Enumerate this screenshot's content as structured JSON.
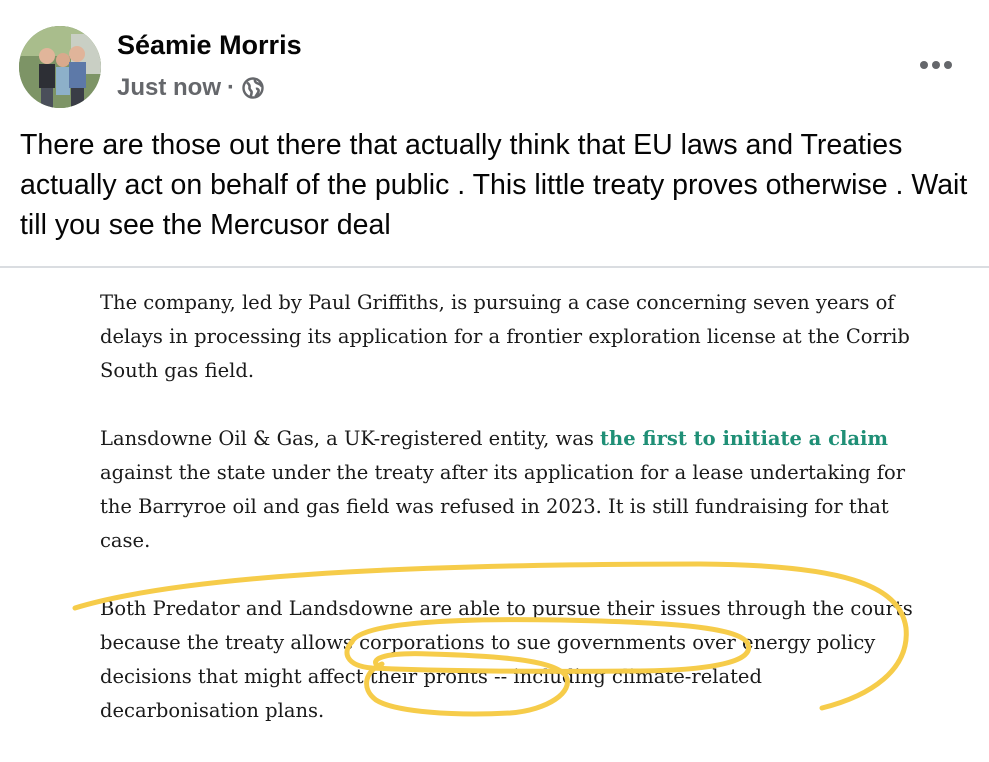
{
  "post": {
    "author": "Séamie Morris",
    "timestamp": "Just now",
    "separator": "·",
    "audience_icon": "globe-icon",
    "more_icon": "more-options-icon",
    "text": "There are those out there that actually think that EU laws and Treaties actually act on behalf of the public . This little treaty proves otherwise . Wait till you see the Mercusor deal"
  },
  "article": {
    "p1": "The company, led by Paul Griffiths, is pursuing a case concerning seven years of delays in processing its application for a frontier exploration license at the Corrib South gas field.",
    "p2_link": "the first to initiate a claim",
    "p2_before": "Lansdowne Oil & Gas, a UK-registered entity, was ",
    "p2_after": " against the state under the treaty after its application for a lease undertaking for the Barryroe oil and gas field was refused in 2023. It is still fundraising for that case.",
    "p3": "Both Predator and Landsdowne are able to pursue their issues through the courts because the treaty allows corporations to sue governments over energy policy decisions that might affect their profits -- including climate-related decarbonisation plans."
  },
  "colors": {
    "link": "#1f8f76",
    "highlighter": "#f6cc4a",
    "meta": "#65676b"
  }
}
